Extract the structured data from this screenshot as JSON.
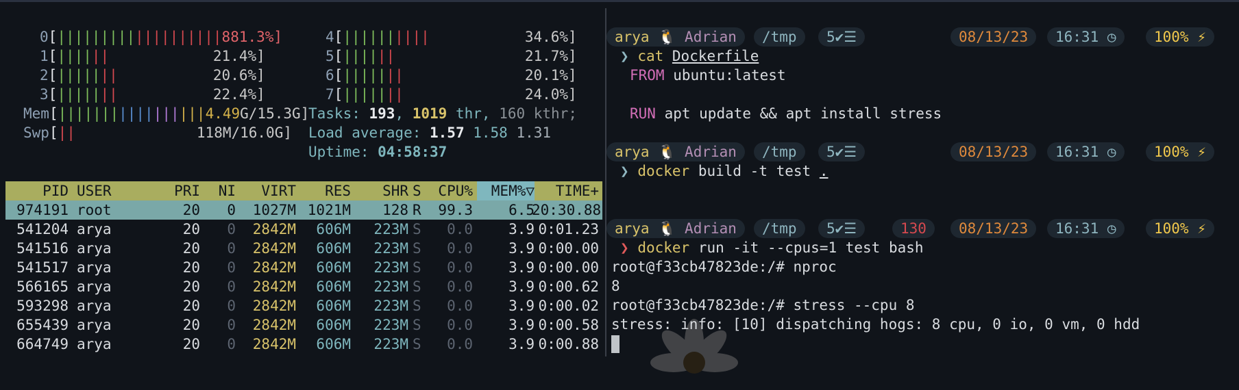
{
  "htop": {
    "cpus": [
      {
        "id": "0",
        "pct": "81.3%]"
      },
      {
        "id": "1",
        "pct": "21.4%]"
      },
      {
        "id": "2",
        "pct": "20.6%]"
      },
      {
        "id": "3",
        "pct": "22.4%]"
      },
      {
        "id": "4",
        "pct": "34.6%]"
      },
      {
        "id": "5",
        "pct": "21.7%]"
      },
      {
        "id": "6",
        "pct": "20.1%]"
      },
      {
        "id": "7",
        "pct": "24.0%]"
      }
    ],
    "mem": {
      "label": "Mem",
      "used": "4.49",
      "total": "G/15.3G]"
    },
    "swp": {
      "label": "Swp",
      "value": "118M/16.0G]"
    },
    "tasks": {
      "label": "Tasks: ",
      "count": "193",
      "thr": "1019",
      "thr_label": " thr, ",
      "kthr": "160 kthr;"
    },
    "load": {
      "label": "Load average: ",
      "l1": "1.57",
      "l5": "1.58",
      "l15": "1.31"
    },
    "uptime": {
      "label": "Uptime: ",
      "value": "04:58:37"
    },
    "columns": {
      "pid": "PID",
      "user": "USER",
      "pri": "PRI",
      "ni": "NI",
      "virt": "VIRT",
      "res": "RES",
      "shr": "SHR",
      "s": "S",
      "cpu": "CPU%",
      "mem": "MEM%▽",
      "time": "TIME+"
    },
    "processes": [
      {
        "pid": "974191",
        "user": "root",
        "pri": "20",
        "ni": "0",
        "virt": "1027M",
        "res": "1021M",
        "shr": "128",
        "s": "R",
        "cpu": "99.3",
        "mem": "6.5",
        "time": "20:30.88"
      },
      {
        "pid": "541204",
        "user": "arya",
        "pri": "20",
        "ni": "0",
        "virt": "2842M",
        "res": "606M",
        "shr": "223M",
        "s": "S",
        "cpu": "0.0",
        "mem": "3.9",
        "time": "0:01.23"
      },
      {
        "pid": "541516",
        "user": "arya",
        "pri": "20",
        "ni": "0",
        "virt": "2842M",
        "res": "606M",
        "shr": "223M",
        "s": "S",
        "cpu": "0.0",
        "mem": "3.9",
        "time": "0:00.00"
      },
      {
        "pid": "541517",
        "user": "arya",
        "pri": "20",
        "ni": "0",
        "virt": "2842M",
        "res": "606M",
        "shr": "223M",
        "s": "S",
        "cpu": "0.0",
        "mem": "3.9",
        "time": "0:00.00"
      },
      {
        "pid": "566165",
        "user": "arya",
        "pri": "20",
        "ni": "0",
        "virt": "2842M",
        "res": "606M",
        "shr": "223M",
        "s": "S",
        "cpu": "0.0",
        "mem": "3.9",
        "time": "0:00.62"
      },
      {
        "pid": "593298",
        "user": "arya",
        "pri": "20",
        "ni": "0",
        "virt": "2842M",
        "res": "606M",
        "shr": "223M",
        "s": "S",
        "cpu": "0.0",
        "mem": "3.9",
        "time": "0:00.02"
      },
      {
        "pid": "655439",
        "user": "arya",
        "pri": "20",
        "ni": "0",
        "virt": "2842M",
        "res": "606M",
        "shr": "223M",
        "s": "S",
        "cpu": "0.0",
        "mem": "3.9",
        "time": "0:00.58"
      },
      {
        "pid": "664749",
        "user": "arya",
        "pri": "20",
        "ni": "0",
        "virt": "2842M",
        "res": "606M",
        "shr": "223M",
        "s": "S",
        "cpu": "0.0",
        "mem": "3.9",
        "time": "0:00.88"
      }
    ]
  },
  "shell": {
    "prompt": {
      "user": "arya",
      "host": "Adrian",
      "dir": "/tmp",
      "jobs": "5",
      "date": "08/13/23",
      "time": "16:31",
      "battery": "100%",
      "exit_code": "130"
    },
    "chevron": "❯",
    "block1": {
      "cmd": "cat",
      "arg": "Dockerfile",
      "line1_kw": "FROM",
      "line1_rest": " ubuntu:latest",
      "line2_kw": "RUN",
      "line2_rest": " apt update && apt install stress"
    },
    "block2": {
      "cmd": "docker",
      "args": " build -t test ",
      "dot": "."
    },
    "block3": {
      "cmd": "docker",
      "args": " run -it --cpus=1 test bash"
    },
    "out1": "root@f33cb47823de:/# nproc",
    "out2": "8",
    "out3": "root@f33cb47823de:/# stress --cpu 8",
    "out4": "stress: info: [10] dispatching hogs: 8 cpu, 0 io, 0 vm, 0 hdd"
  },
  "colors": {
    "header_bg": "#a9ad5f",
    "selected_row": "#7aa8a8",
    "bg": "#10141a"
  },
  "icons": [
    "linux-penguin-icon",
    "checklist-icon",
    "clock-icon",
    "bolt-icon"
  ]
}
